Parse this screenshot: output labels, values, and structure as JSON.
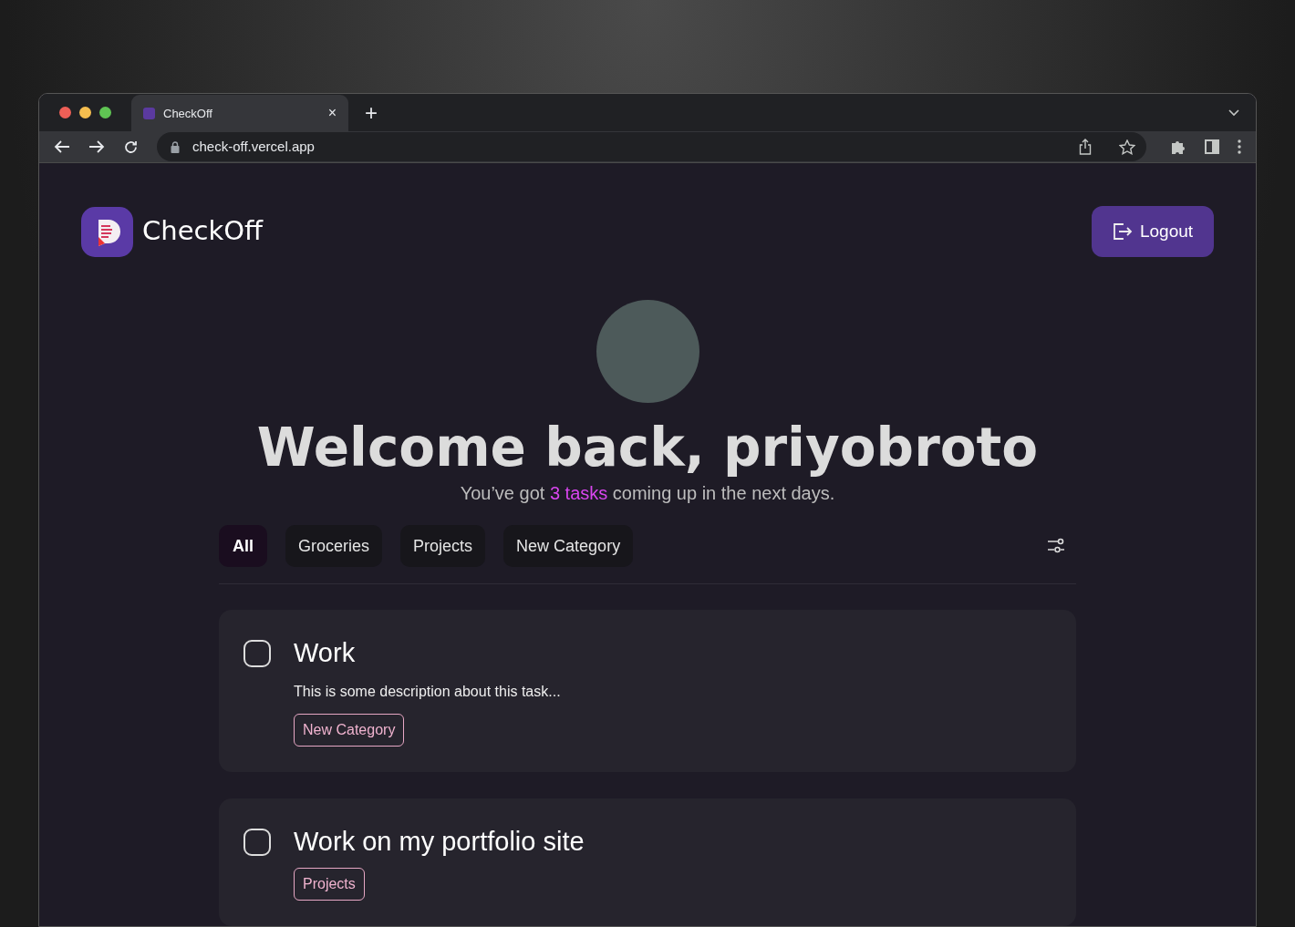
{
  "browser": {
    "tab_title": "CheckOff",
    "tab_close": "×",
    "new_tab": "+",
    "url": "check-off.vercel.app"
  },
  "header": {
    "app_name": "CheckOff",
    "logout": "Logout"
  },
  "welcome": {
    "title": "Welcome back, priyobroto",
    "subtitle_before": "You’ve got ",
    "subtitle_highlight": "3 tasks",
    "subtitle_after": " coming up in the next days."
  },
  "categories": [
    {
      "label": "All",
      "selected": true
    },
    {
      "label": "Groceries",
      "selected": false
    },
    {
      "label": "Projects",
      "selected": false
    },
    {
      "label": "New Category",
      "selected": false
    }
  ],
  "tasks": [
    {
      "title": "Work",
      "description": "This is some description about this task...",
      "tag": "New Category",
      "checked": false
    },
    {
      "title": "Work on my portfolio site",
      "tag": "Projects",
      "checked": false
    }
  ]
}
